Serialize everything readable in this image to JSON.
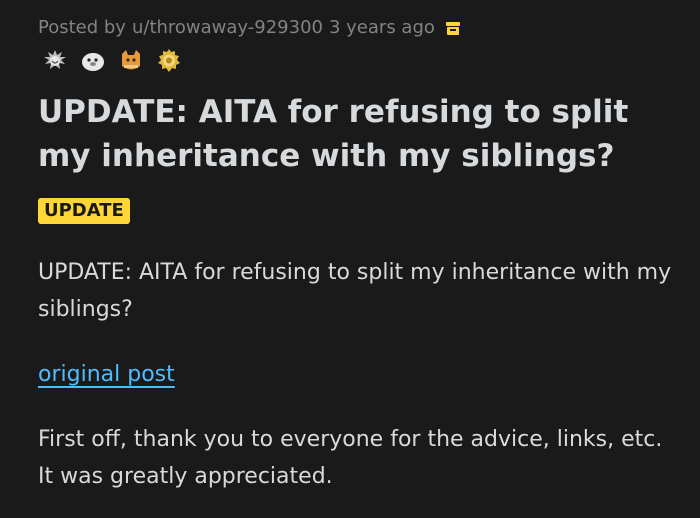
{
  "post": {
    "posted_by_prefix": "Posted by",
    "author": "u/throwaway-929300",
    "age": "3 years ago",
    "archived_icon": "archive-icon",
    "awards": [
      {
        "icon": "wholesome-seal-award-icon",
        "color": "#cfcfcf"
      },
      {
        "icon": "seal-award-icon",
        "color": "#e8e8e8"
      },
      {
        "icon": "cat-award-icon",
        "color": "#e69a3c"
      },
      {
        "icon": "gold-award-icon",
        "color": "#e0b93b"
      }
    ],
    "title": "UPDATE: AITA for refusing to split my inheritance with my siblings?",
    "flair": "UPDATE",
    "flair_color": "#ffd635",
    "paragraph_1": "UPDATE: AITA for refusing to split my inheritance with my siblings?",
    "link_label": "original post",
    "link_color": "#4fbcff",
    "paragraph_2": "First off, thank you to everyone for the advice, links, etc. It was greatly appreciated."
  }
}
